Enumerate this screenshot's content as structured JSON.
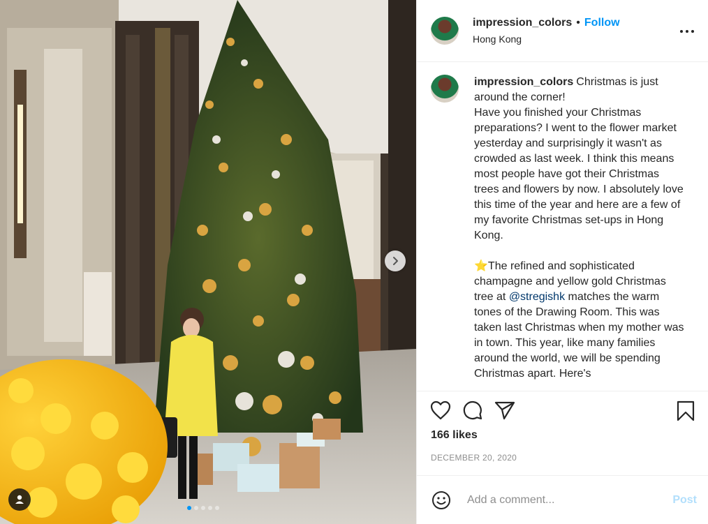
{
  "post": {
    "username": "impression_colors",
    "separator": "•",
    "follow_label": "Follow",
    "location": "Hong Kong",
    "more_icon": "more-options-icon",
    "photo_count": 5,
    "photo_active_index": 1
  },
  "caption": {
    "username": "impression_colors",
    "lines": [
      "Christmas is just around the corner!",
      "Have you finished your Christmas preparations? I went to the flower market yesterday and surprisingly it wasn't as crowded as last week. I think this means most people have got their Christmas trees and flowers by now. I absolutely love this time of the year and here are a few of my favorite Christmas set-ups in Hong Kong."
    ],
    "star_emoji": "⭐",
    "para2_before": "The refined and sophisticated champagne and yellow gold Christmas tree at ",
    "mention": "@stregishk",
    "para2_after": " matches the warm tones of the Drawing Room. This was taken last Christmas when my mother was in town. This year, like many families around the world, we will be spending Christmas apart. Here's"
  },
  "actions": {
    "like_icon": "heart-icon",
    "comment_icon": "comment-icon",
    "share_icon": "share-icon",
    "save_icon": "bookmark-icon"
  },
  "likes": "166 likes",
  "date": "DECEMBER 20, 2020",
  "comment": {
    "placeholder": "Add a comment...",
    "post_label": "Post",
    "emoji_icon": "smiley-icon"
  },
  "colors": {
    "accent": "#0095f6",
    "post_disabled": "#b2dffc",
    "mention": "#00376b",
    "muted": "#8e8e8e"
  }
}
